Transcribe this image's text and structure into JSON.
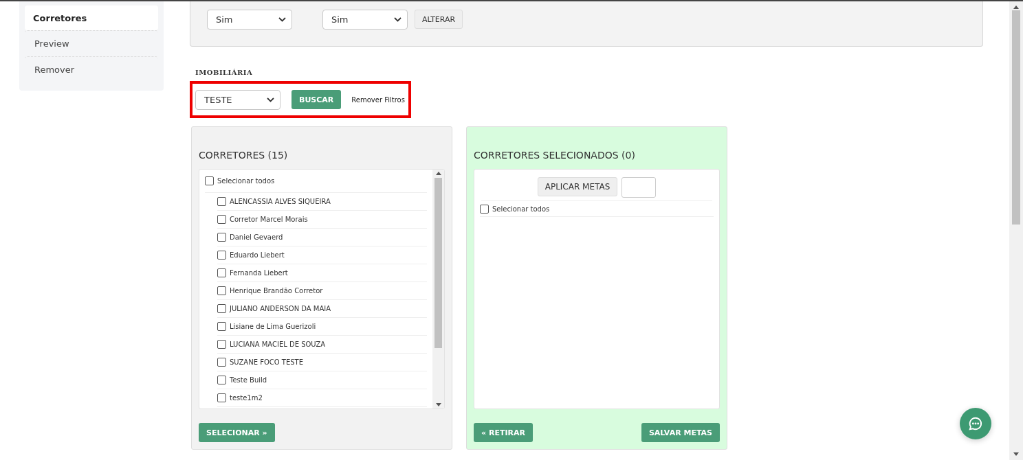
{
  "sidebar": {
    "items": [
      {
        "label": "Corretores",
        "selected": true
      },
      {
        "label": "Preview",
        "selected": false
      },
      {
        "label": "Remover",
        "selected": false
      }
    ]
  },
  "top_panel": {
    "selects": [
      {
        "value": "Sim"
      },
      {
        "value": "Sim"
      }
    ],
    "button": "ALTERAR"
  },
  "filter": {
    "heading": "IMOBILIÁRIA",
    "select": {
      "value": "TESTE"
    },
    "search_button": "BUSCAR",
    "clear_link": "Remover Filtros"
  },
  "brokers": {
    "title": "CORRETORES (15)",
    "select_all": {
      "label": "Selecionar todos",
      "checked": false
    },
    "items": [
      {
        "name": "ALENCASSIA ALVES SIQUEIRA",
        "checked": false
      },
      {
        "name": "Corretor Marcel Morais",
        "checked": false
      },
      {
        "name": "Daniel Gevaerd",
        "checked": false
      },
      {
        "name": "Eduardo Liebert",
        "checked": false
      },
      {
        "name": "Fernanda Liebert",
        "checked": false
      },
      {
        "name": "Henrique Brandão Corretor",
        "checked": false
      },
      {
        "name": "JULIANO ANDERSON DA MAIA",
        "checked": false
      },
      {
        "name": "Lisiane de Lima Guerizoli",
        "checked": false
      },
      {
        "name": "LUCIANA MACIEL DE SOUZA",
        "checked": false
      },
      {
        "name": "SUZANE FOCO TESTE",
        "checked": false
      },
      {
        "name": "Teste Build",
        "checked": false
      },
      {
        "name": "teste1m2",
        "checked": false
      }
    ],
    "button": "SELECIONAR »"
  },
  "selected_brokers": {
    "title": "CORRETORES SELECIONADOS (0)",
    "apply_button": "APLICAR METAS",
    "select_all": {
      "label": "Selecionar todos",
      "checked": false
    },
    "remove_button": "« RETIRAR",
    "save_button": "SALVAR METAS"
  }
}
